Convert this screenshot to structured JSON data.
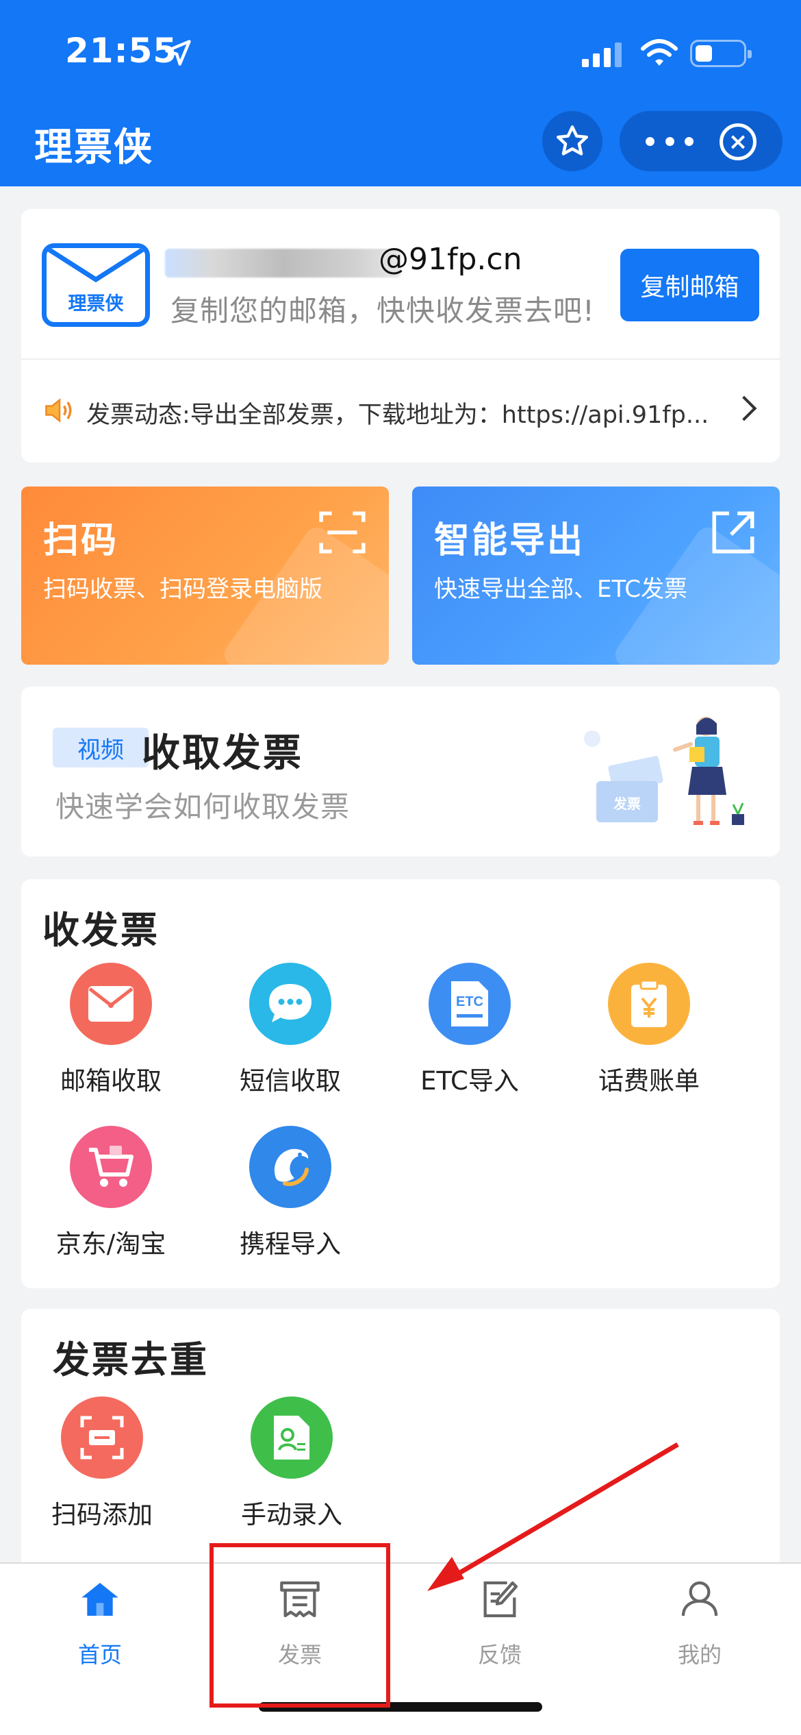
{
  "status_bar": {
    "time": "21:55"
  },
  "header": {
    "title": "理票侠"
  },
  "email_card": {
    "logo_text": "理票侠",
    "email_domain": "@91fp.cn",
    "hint": "复制您的邮箱，快快收发票去吧!",
    "copy_button": "复制邮箱",
    "news": "发票动态:导出全部发票，下载地址为：https://api.91fp..."
  },
  "tiles": [
    {
      "title": "扫码",
      "subtitle": "扫码收票、扫码登录电脑版"
    },
    {
      "title": "智能导出",
      "subtitle": "快速导出全部、ETC发票"
    }
  ],
  "video_card": {
    "tag": "视频",
    "title": "收取发票",
    "subtitle": "快速学会如何收取发票",
    "illustration_text": "发票"
  },
  "receive_section": {
    "title": "收发票",
    "items": [
      {
        "label": "邮箱收取",
        "icon": "mail-icon",
        "color": "#f36a5c"
      },
      {
        "label": "短信收取",
        "icon": "sms-icon",
        "color": "#29b8e8"
      },
      {
        "label": "ETC导入",
        "icon": "etc-icon",
        "color": "#3d8ef2",
        "icon_text": "ETC"
      },
      {
        "label": "话费账单",
        "icon": "bill-icon",
        "color": "#fbb23d"
      },
      {
        "label": "京东/淘宝",
        "icon": "cart-icon",
        "color": "#f35f87"
      },
      {
        "label": "携程导入",
        "icon": "ctrip-icon",
        "color": "#2f88ea"
      }
    ]
  },
  "dedupe_section": {
    "title": "发票去重",
    "items": [
      {
        "label": "扫码添加",
        "icon": "scan-add-icon",
        "color": "#f46a5e"
      },
      {
        "label": "手动录入",
        "icon": "manual-entry-icon",
        "color": "#3fbf4a"
      }
    ]
  },
  "tabbar": {
    "items": [
      {
        "label": "首页",
        "icon": "home-icon",
        "active": true
      },
      {
        "label": "发票",
        "icon": "invoice-icon",
        "active": false
      },
      {
        "label": "反馈",
        "icon": "feedback-icon",
        "active": false
      },
      {
        "label": "我的",
        "icon": "profile-icon",
        "active": false
      }
    ]
  },
  "colors": {
    "brand": "#1377f6",
    "scan_tile": "#ff8a3a",
    "export_tile": "#3e8bf7",
    "annotation": "#e51b1b"
  }
}
